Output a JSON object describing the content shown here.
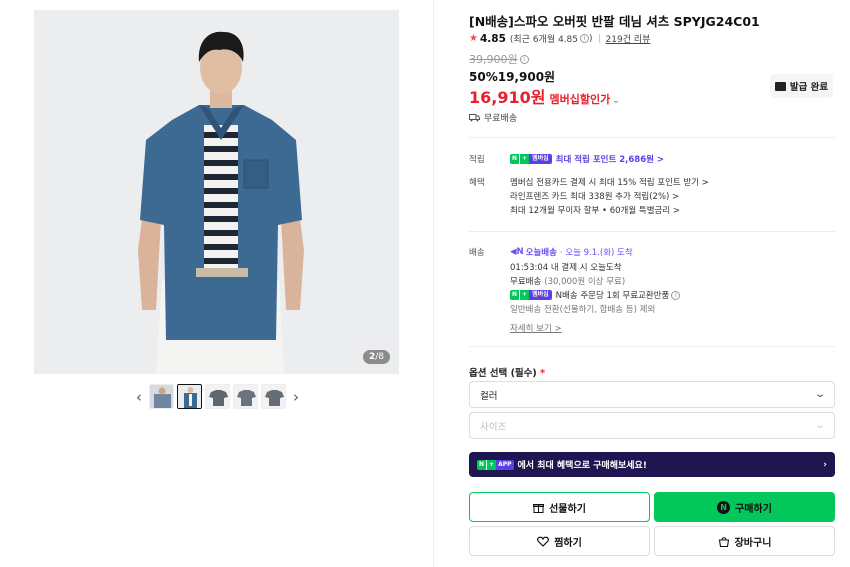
{
  "gallery": {
    "counter_current": "2",
    "counter_total": "/8",
    "prev_label": "‹",
    "next_label": "›"
  },
  "product": {
    "title": "[N배송]스파오 오버핏 반팔 데님 셔츠 SPYJG24C01",
    "rating": "4.85",
    "rating_detail": "(최근 6개월 4.85",
    "rating_detail_end": ")",
    "reviews": "219건 리뷰",
    "original_price": "39,900원",
    "discount_rate": "50%",
    "sale_price": "19,900원",
    "member_price": "16,910원",
    "member_label": "멤버십할인가",
    "coupon_label": "발급 완료",
    "shipping_free": "무료배송"
  },
  "points": {
    "label": "적립",
    "badge_n": "N",
    "badge_p": "+",
    "badge_m": "멤버십",
    "text": "최대 적립 포인트 2,686원 >"
  },
  "benefits": {
    "label": "혜택",
    "lines": [
      "멤버십 전용카드 결제 시 최대 15% 적립 포인트 받기 >",
      "라인프렌즈 카드 최대 338원 추가 적립(2%) >",
      "최대 12개월 무이자 할부 • 60개월 특별금리 >"
    ]
  },
  "delivery": {
    "label": "배송",
    "today": "오늘배송",
    "today_date": "· 오늘 9.1.(화) 도착",
    "cutoff": "01:53:04 내 결제 시 오늘도착",
    "free": "무료배송",
    "free_cond": "(30,000원 이상 무료)",
    "exchange": "N배송 주문당 1회 무료교환반품",
    "normal": "일반배송 전환(선물하기, 합배송 등) 제외",
    "more": "자세히 보기 >"
  },
  "options": {
    "title": "옵션 선택 (필수)",
    "required_mark": "*",
    "color_placeholder": "컬러",
    "size_placeholder": "사이즈"
  },
  "app_banner": {
    "badge_n": "N",
    "badge_p": "+",
    "badge_app": "APP",
    "text": "에서 최대 혜택으로 구매해보세요!",
    "arrow": "›"
  },
  "buttons": {
    "gift": "선물하기",
    "buy": "구매하기",
    "wish": "찜하기",
    "cart": "장바구니",
    "buy_icon": "N"
  },
  "colors": {
    "naver_green": "#03c75a",
    "price_red": "#e8202e",
    "membership_purple": "#5c40e6",
    "banner_navy": "#1d1650"
  }
}
